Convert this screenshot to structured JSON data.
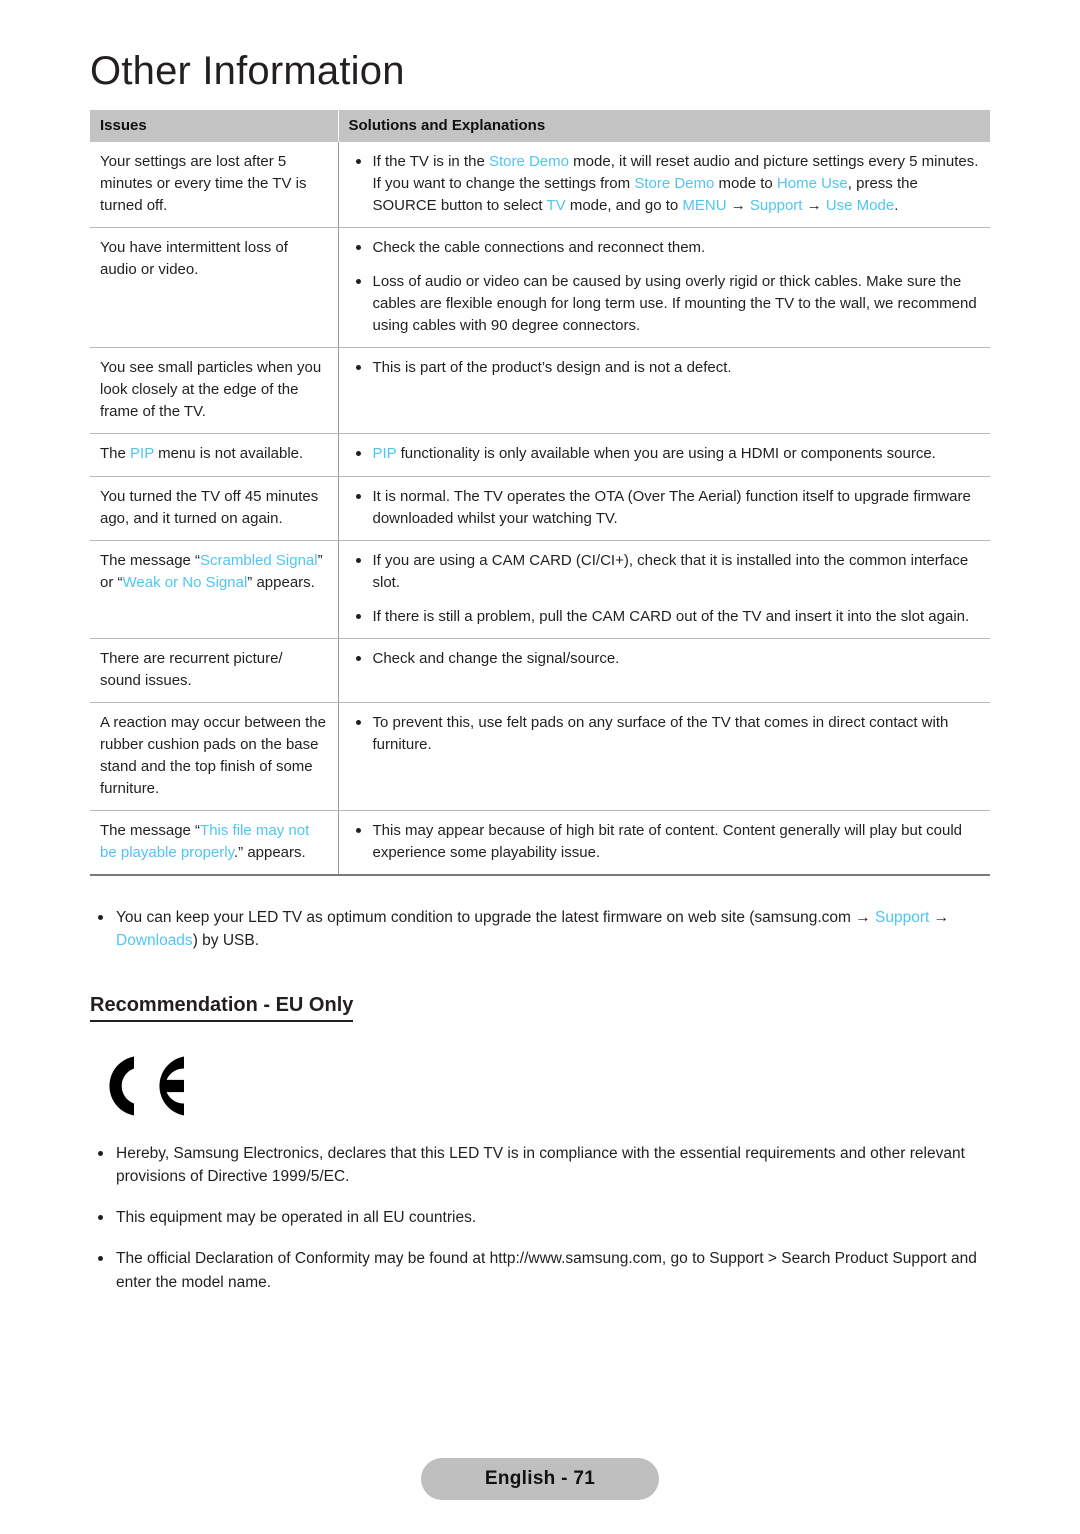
{
  "page": {
    "title": "Other Information",
    "footer_label": "English - 71",
    "accent_color": "#4fc6f0",
    "header_bg": "#c3c3c3",
    "text_color": "#231f20"
  },
  "table": {
    "headers": [
      "Issues",
      "Solutions and Explanations"
    ],
    "rows": [
      {
        "issue_parts": [
          {
            "t": "Your settings are lost after 5 minutes or every time the TV is turned off.",
            "hl": false
          }
        ],
        "solutions": [
          [
            {
              "t": "If the TV is in the ",
              "hl": false
            },
            {
              "t": "Store Demo",
              "hl": true
            },
            {
              "t": " mode, it will reset audio and picture settings every 5 minutes. If you want to change the settings from ",
              "hl": false
            },
            {
              "t": "Store Demo",
              "hl": true
            },
            {
              "t": " mode to ",
              "hl": false
            },
            {
              "t": "Home Use",
              "hl": true
            },
            {
              "t": ", press the SOURCE button to select ",
              "hl": false
            },
            {
              "t": "TV",
              "hl": true
            },
            {
              "t": " mode, and go to ",
              "hl": false
            },
            {
              "t": "MENU",
              "hl": true
            },
            {
              "t": " → ",
              "hl": false
            },
            {
              "t": "Support",
              "hl": true
            },
            {
              "t": " → ",
              "hl": false
            },
            {
              "t": "Use Mode",
              "hl": true
            },
            {
              "t": ".",
              "hl": false
            }
          ]
        ]
      },
      {
        "issue_parts": [
          {
            "t": "You have intermittent loss of audio or video.",
            "hl": false
          }
        ],
        "solutions": [
          [
            {
              "t": "Check the cable connections and reconnect them.",
              "hl": false
            }
          ],
          [
            {
              "t": "Loss of audio or video can be caused by using overly rigid or thick cables. Make sure the cables are flexible enough for long term use. If mounting the TV to the wall, we recommend using cables with 90 degree connectors.",
              "hl": false
            }
          ]
        ]
      },
      {
        "issue_parts": [
          {
            "t": "You see small particles when you look closely at the edge of the frame of the TV.",
            "hl": false
          }
        ],
        "solutions": [
          [
            {
              "t": "This is part of the product’s design and is not a defect.",
              "hl": false
            }
          ]
        ]
      },
      {
        "issue_parts": [
          {
            "t": "The ",
            "hl": false
          },
          {
            "t": "PIP",
            "hl": true
          },
          {
            "t": " menu is not available.",
            "hl": false
          }
        ],
        "solutions": [
          [
            {
              "t": "PIP",
              "hl": true
            },
            {
              "t": " functionality is only available when you are using a HDMI or components source.",
              "hl": false
            }
          ]
        ]
      },
      {
        "issue_parts": [
          {
            "t": "You turned the TV off 45 minutes ago, and it turned on again.",
            "hl": false
          }
        ],
        "solutions": [
          [
            {
              "t": "It is normal. The TV operates the OTA (Over The Aerial) function itself to upgrade firmware downloaded whilst your watching TV.",
              "hl": false
            }
          ]
        ]
      },
      {
        "issue_parts": [
          {
            "t": "The message “",
            "hl": false
          },
          {
            "t": "Scrambled Signal",
            "hl": true
          },
          {
            "t": "” or “",
            "hl": false
          },
          {
            "t": "Weak or No Signal",
            "hl": true
          },
          {
            "t": "” appears.",
            "hl": false
          }
        ],
        "solutions": [
          [
            {
              "t": "If you are using a CAM CARD (CI/CI+), check that it is installed into the common interface slot.",
              "hl": false
            }
          ],
          [
            {
              "t": "If there is still a problem, pull the CAM CARD out of the TV and insert it into the slot again.",
              "hl": false
            }
          ]
        ]
      },
      {
        "issue_parts": [
          {
            "t": "There are recurrent picture/ sound issues.",
            "hl": false
          }
        ],
        "solutions": [
          [
            {
              "t": "Check and change the signal/source.",
              "hl": false
            }
          ]
        ]
      },
      {
        "issue_parts": [
          {
            "t": "A reaction may occur between the rubber cushion pads on the base stand and the top finish of some furniture.",
            "hl": false
          }
        ],
        "solutions": [
          [
            {
              "t": "To prevent this, use felt pads on any surface of the TV that comes in direct contact with furniture.",
              "hl": false
            }
          ]
        ]
      },
      {
        "issue_parts": [
          {
            "t": "The message “",
            "hl": false
          },
          {
            "t": "This file may not be playable properly",
            "hl": true
          },
          {
            "t": ".” appears.",
            "hl": false
          }
        ],
        "solutions": [
          [
            {
              "t": "This may appear because of high bit rate of content. Content generally will play but could experience some playability issue.",
              "hl": false
            }
          ]
        ]
      }
    ]
  },
  "note": {
    "bullets": [
      [
        {
          "t": "You can keep your LED TV as optimum condition to upgrade the latest firmware on web site (samsung.com → ",
          "hl": false
        },
        {
          "t": "Support",
          "hl": true
        },
        {
          "t": " → ",
          "hl": false
        },
        {
          "t": "Downloads",
          "hl": true
        },
        {
          "t": ") by USB.",
          "hl": false
        }
      ]
    ]
  },
  "recommendation": {
    "heading": "Recommendation - EU Only",
    "ce_mark_label": "CE",
    "bullets": [
      [
        {
          "t": "Hereby, Samsung Electronics, declares that this LED TV is in compliance with the essential requirements and other relevant provisions of Directive 1999/5/EC.",
          "hl": false
        }
      ],
      [
        {
          "t": "This equipment may be operated in all EU countries.",
          "hl": false
        }
      ],
      [
        {
          "t": "The official Declaration of Conformity may be found at http://www.samsung.com, go to Support > Search Product Support and enter the model name.",
          "hl": false
        }
      ]
    ]
  }
}
